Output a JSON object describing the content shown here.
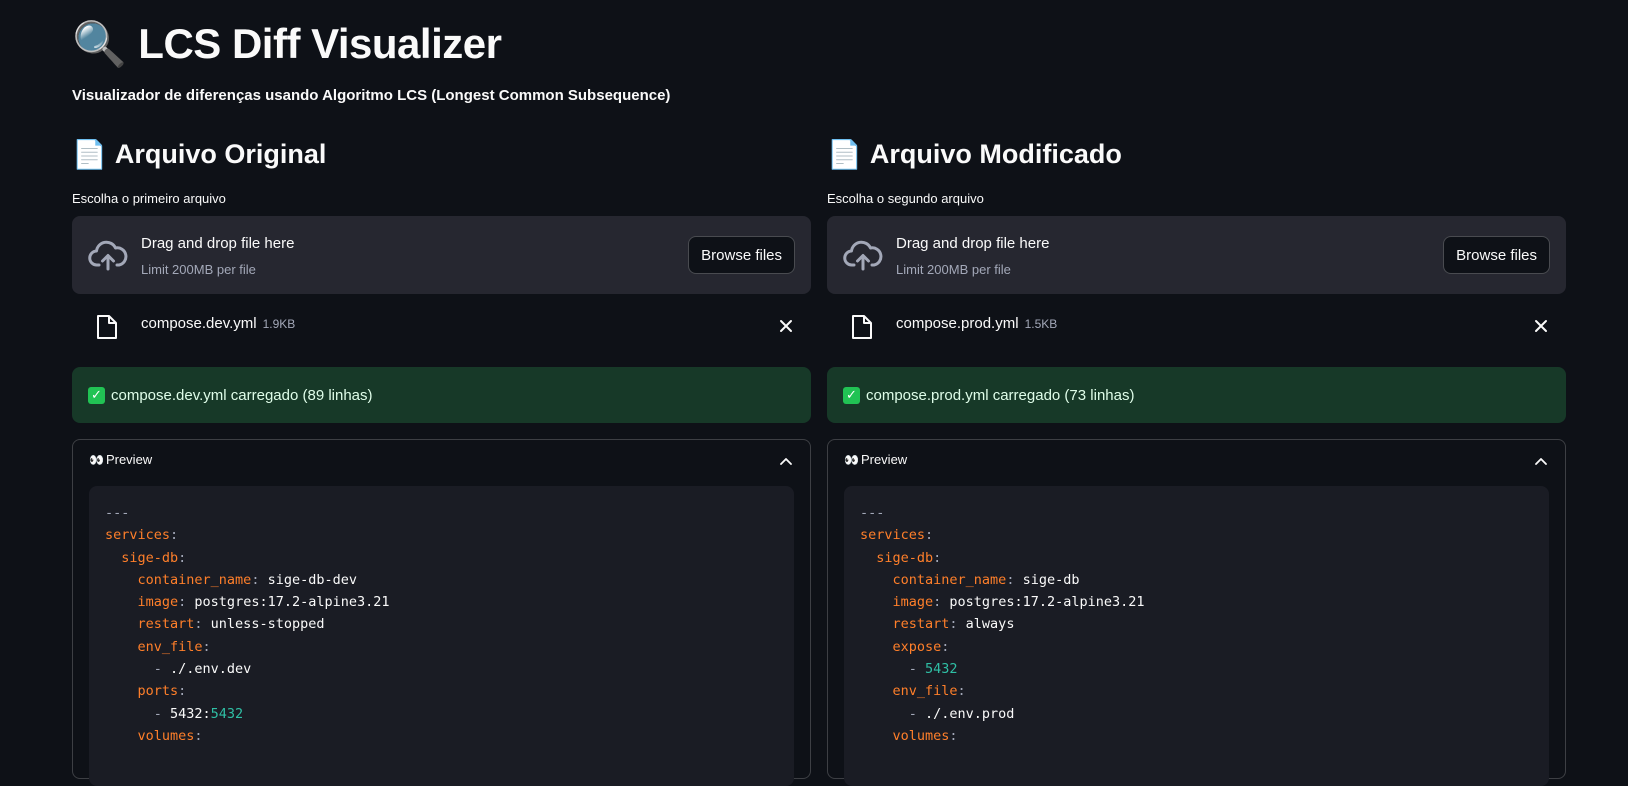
{
  "header": {
    "title": "LCS Diff Visualizer",
    "title_icon": "🔍",
    "subtitle": "Visualizador de diferenças usando Algoritmo LCS (Longest Common Subsequence)"
  },
  "left": {
    "heading": "Arquivo Original",
    "heading_icon": "📄",
    "uploader_label": "Escolha o primeiro arquivo",
    "drop_text": "Drag and drop file here",
    "limit_text": "Limit 200MB per file",
    "browse_label": "Browse files",
    "file_name": "compose.dev.yml",
    "file_size": "1.9KB",
    "success_message": "compose.dev.yml carregado (89 linhas)",
    "preview_label": "Preview",
    "code_lines": [
      [
        [
          "comment",
          "---"
        ]
      ],
      [
        [
          "key",
          "services"
        ],
        [
          "punct",
          ":"
        ]
      ],
      [
        [
          "key",
          "  sige-db"
        ],
        [
          "punct",
          ":"
        ]
      ],
      [
        [
          "key",
          "    container_name"
        ],
        [
          "punct",
          ":"
        ],
        [
          "str",
          " sige-db-dev"
        ]
      ],
      [
        [
          "key",
          "    image"
        ],
        [
          "punct",
          ":"
        ],
        [
          "str",
          " postgres:17.2-alpine3.21"
        ]
      ],
      [
        [
          "key",
          "    restart"
        ],
        [
          "punct",
          ":"
        ],
        [
          "str",
          " unless-stopped"
        ]
      ],
      [
        [
          "key",
          "    env_file"
        ],
        [
          "punct",
          ":"
        ]
      ],
      [
        [
          "punct",
          "      - "
        ],
        [
          "str",
          "./.env.dev"
        ]
      ],
      [
        [
          "key",
          "    ports"
        ],
        [
          "punct",
          ":"
        ]
      ],
      [
        [
          "punct",
          "      - "
        ],
        [
          "str",
          "5432:"
        ],
        [
          "num",
          "5432"
        ]
      ],
      [
        [
          "key",
          "    volumes"
        ],
        [
          "punct",
          ":"
        ]
      ]
    ]
  },
  "right": {
    "heading": "Arquivo Modificado",
    "heading_icon": "📄",
    "uploader_label": "Escolha o segundo arquivo",
    "drop_text": "Drag and drop file here",
    "limit_text": "Limit 200MB per file",
    "browse_label": "Browse files",
    "file_name": "compose.prod.yml",
    "file_size": "1.5KB",
    "success_message": "compose.prod.yml carregado (73 linhas)",
    "preview_label": "Preview",
    "code_lines": [
      [
        [
          "comment",
          "---"
        ]
      ],
      [
        [
          "key",
          "services"
        ],
        [
          "punct",
          ":"
        ]
      ],
      [
        [
          "key",
          "  sige-db"
        ],
        [
          "punct",
          ":"
        ]
      ],
      [
        [
          "key",
          "    container_name"
        ],
        [
          "punct",
          ":"
        ],
        [
          "str",
          " sige-db"
        ]
      ],
      [
        [
          "key",
          "    image"
        ],
        [
          "punct",
          ":"
        ],
        [
          "str",
          " postgres:17.2-alpine3.21"
        ]
      ],
      [
        [
          "key",
          "    restart"
        ],
        [
          "punct",
          ":"
        ],
        [
          "str",
          " always"
        ]
      ],
      [
        [
          "key",
          "    expose"
        ],
        [
          "punct",
          ":"
        ]
      ],
      [
        [
          "punct",
          "      - "
        ],
        [
          "num",
          "5432"
        ]
      ],
      [
        [
          "key",
          "    env_file"
        ],
        [
          "punct",
          ":"
        ]
      ],
      [
        [
          "punct",
          "      - "
        ],
        [
          "str",
          "./.env.prod"
        ]
      ],
      [
        [
          "key",
          "    volumes"
        ],
        [
          "punct",
          ":"
        ]
      ]
    ]
  },
  "colors": {
    "background": "#0e1117",
    "panel": "#262730",
    "success_bg": "#173928",
    "yaml_key": "#ff7f2a",
    "yaml_number": "#2fbfa5"
  }
}
